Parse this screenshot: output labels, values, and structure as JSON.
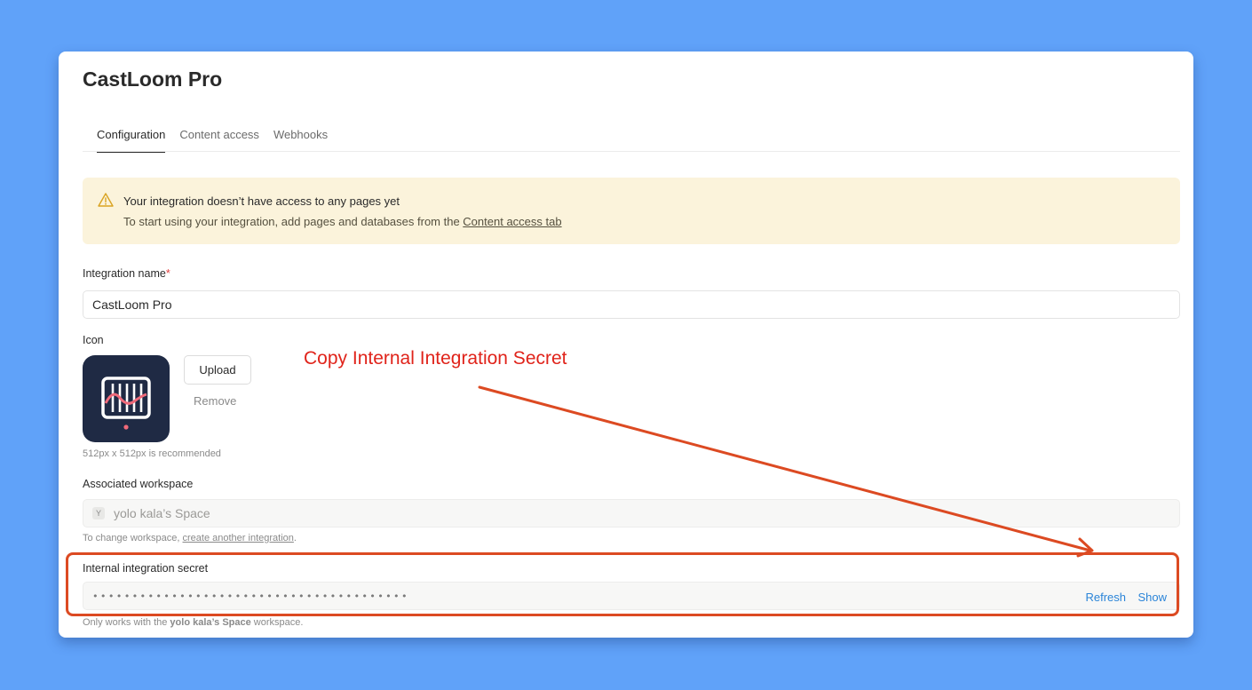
{
  "app": {
    "title": "CastLoom Pro",
    "tabs": [
      {
        "label": "Configuration",
        "active": true
      },
      {
        "label": "Content access",
        "active": false
      },
      {
        "label": "Webhooks",
        "active": false
      }
    ]
  },
  "banner": {
    "title": "Your integration doesn’t have access to any pages yet",
    "body_prefix": "To start using your integration, add pages and databases from the ",
    "link": "Content access tab",
    "icon": "warning-icon",
    "bg_color": "#fbf3db"
  },
  "integration_name": {
    "label": "Integration name",
    "required_mark": "*",
    "value": "CastLoom Pro"
  },
  "icon_section": {
    "label": "Icon",
    "upload_label": "Upload",
    "remove_label": "Remove",
    "hint": "512px x 512px is recommended"
  },
  "workspace": {
    "label": "Associated workspace",
    "badge": "Y",
    "value": "yolo kala’s Space",
    "hint_prefix": "To change workspace, ",
    "hint_link": "create another integration",
    "hint_suffix": "."
  },
  "secret": {
    "label": "Internal integration secret",
    "masked_value": "••••••••••••••••••••••••••••••••••••••••",
    "refresh_label": "Refresh",
    "show_label": "Show",
    "hint_prefix": "Only works with the ",
    "hint_workspace": "yolo kala’s Space",
    "hint_suffix": " workspace."
  },
  "annotation": {
    "text": "Copy Internal Integration Secret",
    "color": "#e0231a"
  },
  "colors": {
    "background": "#60a2f9",
    "link_blue": "#2a84d8",
    "annotation_stroke": "#dc4a22"
  }
}
